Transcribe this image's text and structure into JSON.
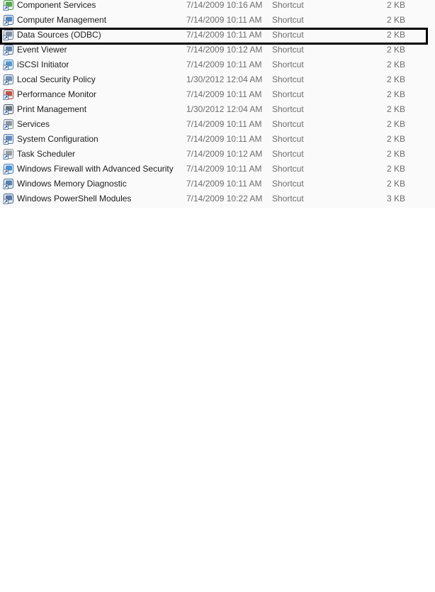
{
  "highlight_color": "#000000",
  "files": [
    {
      "name": "Component Services",
      "date": "7/14/2009 10:16 AM",
      "type": "Shortcut",
      "size": "2 KB",
      "icon": "component-services-icon",
      "color": "#3d9a2c"
    },
    {
      "name": "Computer Management",
      "date": "7/14/2009 10:11 AM",
      "type": "Shortcut",
      "size": "2 KB",
      "icon": "computer-management-icon",
      "color": "#3a6fb0"
    },
    {
      "name": "Data Sources (ODBC)",
      "date": "7/14/2009 10:11 AM",
      "type": "Shortcut",
      "size": "2 KB",
      "icon": "data-sources-icon",
      "color": "#6a7b91",
      "highlighted": true
    },
    {
      "name": "Event Viewer",
      "date": "7/14/2009 10:12 AM",
      "type": "Shortcut",
      "size": "2 KB",
      "icon": "event-viewer-icon",
      "color": "#4a6f9c"
    },
    {
      "name": "iSCSI Initiator",
      "date": "7/14/2009 10:11 AM",
      "type": "Shortcut",
      "size": "2 KB",
      "icon": "iscsi-initiator-icon",
      "color": "#3f86c4"
    },
    {
      "name": "Local Security Policy",
      "date": "1/30/2012 12:04 AM",
      "type": "Shortcut",
      "size": "2 KB",
      "icon": "local-security-policy-icon",
      "color": "#5b7ea3"
    },
    {
      "name": "Performance Monitor",
      "date": "7/14/2009 10:11 AM",
      "type": "Shortcut",
      "size": "2 KB",
      "icon": "performance-monitor-icon",
      "color": "#b33a2f"
    },
    {
      "name": "Print Management",
      "date": "1/30/2012 12:04 AM",
      "type": "Shortcut",
      "size": "2 KB",
      "icon": "print-management-icon",
      "color": "#505a66"
    },
    {
      "name": "Services",
      "date": "7/14/2009 10:11 AM",
      "type": "Shortcut",
      "size": "2 KB",
      "icon": "services-icon",
      "color": "#7a8796"
    },
    {
      "name": "System Configuration",
      "date": "7/14/2009 10:11 AM",
      "type": "Shortcut",
      "size": "2 KB",
      "icon": "system-configuration-icon",
      "color": "#4e79ad"
    },
    {
      "name": "Task Scheduler",
      "date": "7/14/2009 10:12 AM",
      "type": "Shortcut",
      "size": "2 KB",
      "icon": "task-scheduler-icon",
      "color": "#8a8f96"
    },
    {
      "name": "Windows Firewall with Advanced Security",
      "date": "7/14/2009 10:11 AM",
      "type": "Shortcut",
      "size": "2 KB",
      "icon": "windows-firewall-icon",
      "color": "#2f7fc7"
    },
    {
      "name": "Windows Memory Diagnostic",
      "date": "7/14/2009 10:11 AM",
      "type": "Shortcut",
      "size": "2 KB",
      "icon": "memory-diagnostic-icon",
      "color": "#3d6f9e"
    },
    {
      "name": "Windows PowerShell Modules",
      "date": "7/14/2009 10:22 AM",
      "type": "Shortcut",
      "size": "3 KB",
      "icon": "powershell-modules-icon",
      "color": "#3e5d8f"
    }
  ]
}
